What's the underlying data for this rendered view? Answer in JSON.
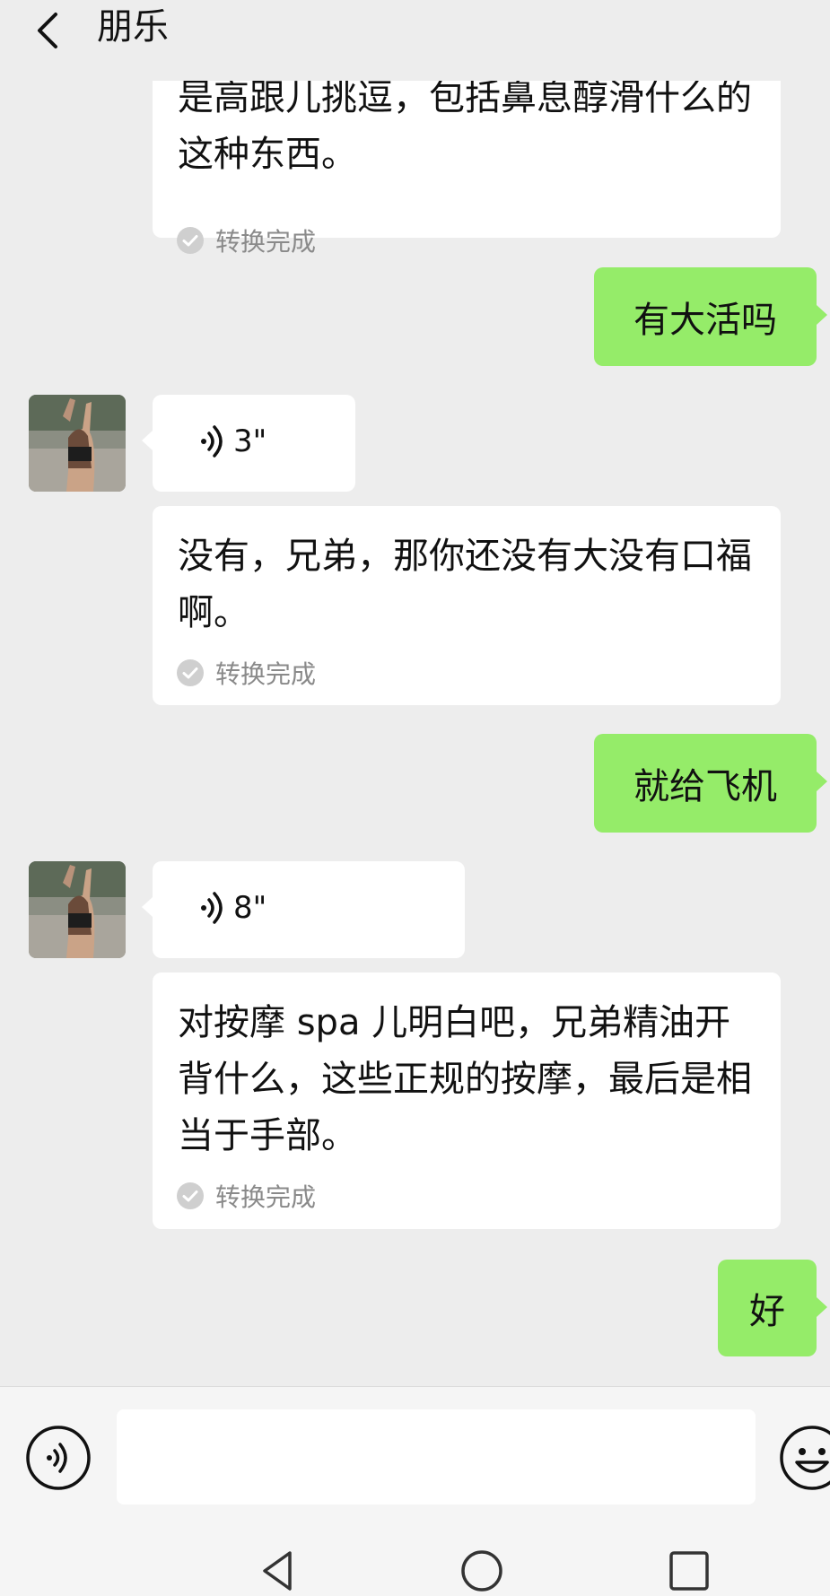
{
  "header": {
    "title": "朋乐"
  },
  "messages": [
    {
      "type": "transcript",
      "text": "是高跟儿挑逗，包括鼻息醇滑什么的这种东西。",
      "status": "转换完成"
    },
    {
      "type": "outgoing",
      "text": "有大活吗"
    },
    {
      "type": "voice",
      "duration": "3\""
    },
    {
      "type": "transcript",
      "text": "没有，兄弟，那你还没有大没有口福啊。",
      "status": "转换完成"
    },
    {
      "type": "outgoing",
      "text": "就给飞机"
    },
    {
      "type": "voice",
      "duration": "8\""
    },
    {
      "type": "transcript",
      "text": "对按摩 spa 儿明白吧，兄弟精油开背什么，这些正规的按摩，最后是相当于手部。",
      "status": "转换完成"
    },
    {
      "type": "outgoing",
      "text": "好"
    }
  ],
  "input": {
    "value": "",
    "placeholder": ""
  },
  "icons": {
    "back": "chevron-left-icon",
    "voice_message": "voice-wave-icon",
    "transcript_done": "check-circle-icon",
    "voice_toggle": "voice-input-icon",
    "emoji": "emoji-icon",
    "nav_back": "triangle-back-icon",
    "nav_home": "circle-home-icon",
    "nav_recent": "square-recent-icon"
  },
  "colors": {
    "background": "#ededed",
    "outgoing_bubble": "#95ec69",
    "incoming_bubble": "#ffffff",
    "status_text": "#8a8a8a"
  }
}
